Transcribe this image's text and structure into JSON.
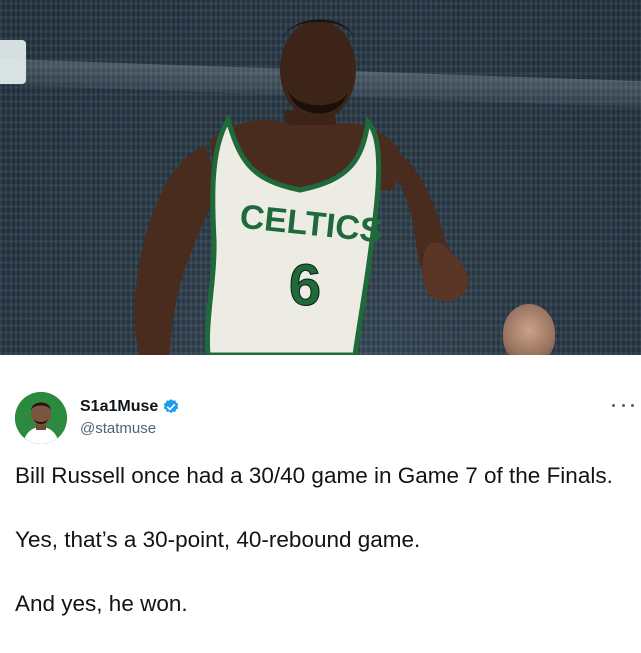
{
  "media": {
    "jersey_team_text": "CELTICS",
    "jersey_number": "6"
  },
  "author": {
    "display_name": "S1a1Muse",
    "handle": "@statmuse",
    "verified": true,
    "avatar_icon": "avatar-illustration"
  },
  "menu": {
    "more_icon": "more-options-icon"
  },
  "tweet": {
    "paragraphs": [
      "Bill Russell once had a 30/40 game in Game 7 of the Finals.",
      "Yes, that’s a 30-point, 40-rebound game.",
      "And yes, he won."
    ]
  },
  "colors": {
    "text_primary": "#0f1419",
    "text_secondary": "#536471",
    "verified_blue": "#1d9bf0",
    "jersey_green": "#1f6a3a"
  }
}
